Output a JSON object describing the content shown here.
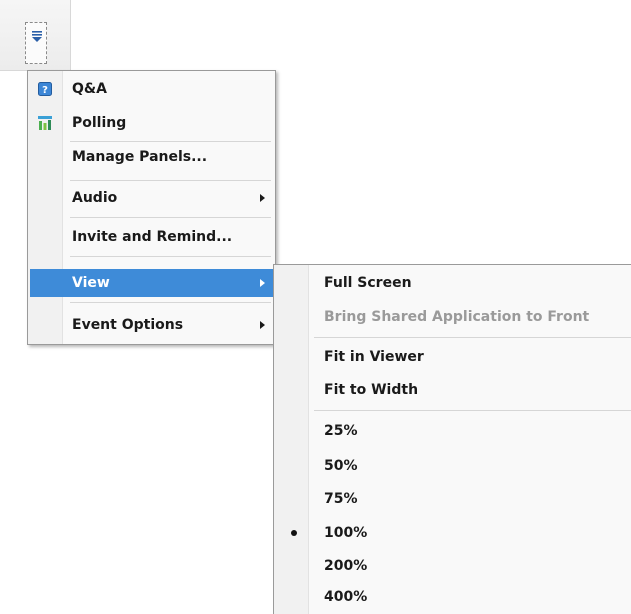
{
  "main_menu": {
    "items": [
      {
        "label": "Q&A",
        "icon": "qa-help-icon"
      },
      {
        "label": "Polling",
        "icon": "polling-bar-chart-icon"
      },
      {
        "label": "Manage Panels..."
      },
      {
        "label": "Audio",
        "has_submenu": true
      },
      {
        "label": "Invite and Remind..."
      },
      {
        "label": "View",
        "has_submenu": true,
        "highlighted": true
      },
      {
        "label": "Event Options",
        "has_submenu": true
      }
    ]
  },
  "view_submenu": {
    "items": [
      {
        "label": "Full Screen"
      },
      {
        "label": "Bring Shared Application to Front",
        "disabled": true
      },
      {
        "label": "Fit in Viewer"
      },
      {
        "label": "Fit to Width"
      },
      {
        "label": "25%"
      },
      {
        "label": "50%"
      },
      {
        "label": "75%"
      },
      {
        "label": "100%",
        "selected": true
      },
      {
        "label": "200%"
      },
      {
        "label": "400%"
      }
    ]
  },
  "colors": {
    "highlight": "#3e8bd8",
    "menu_background": "#f9f9f9",
    "disabled_text": "#9a9a9a"
  }
}
